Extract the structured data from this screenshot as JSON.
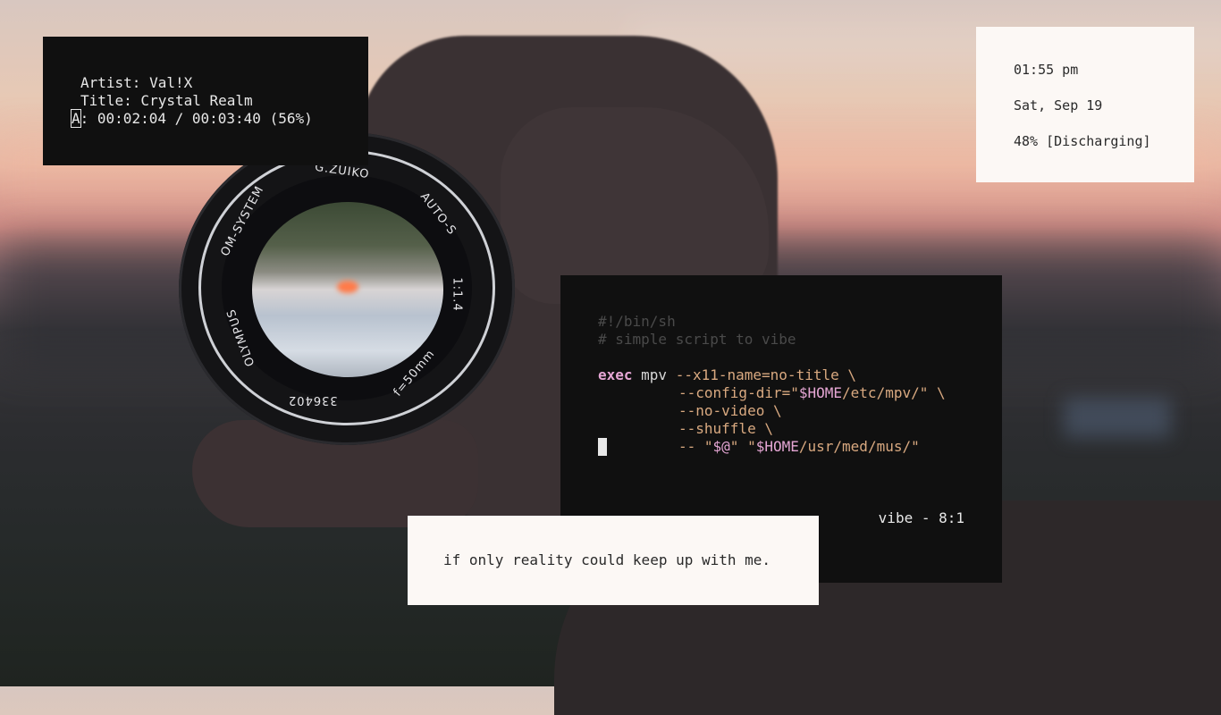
{
  "now_playing": {
    "artist": "Artist: Val!X",
    "title": "Title: Crystal Realm",
    "cursor_char": "A",
    "progress": ": 00:02:04 / 00:03:40 (56%)"
  },
  "status": {
    "time": "01:55 pm",
    "date": "Sat, Sep 19",
    "battery": "48% [Discharging]"
  },
  "lens_text": {
    "a": "G.ZUIKO",
    "b": "AUTO-S",
    "c": "OM-SYSTEM",
    "d": "OLYMPUS",
    "e": "1:1.4",
    "f": "f=50mm",
    "g": "336402"
  },
  "terminal": {
    "line1": "#!/bin/sh",
    "line2": "# simple script to vibe",
    "exec": "exec",
    "mpv": " mpv ",
    "opt1": "--x11-name=no-title \\",
    "opt2a": "--config-dir=\"",
    "home1": "$HOME",
    "opt2b": "/etc/mpv/\" \\",
    "opt3": "--no-video \\",
    "opt4": "--shuffle \\",
    "opt5a": "-- \"",
    "args": "$@",
    "opt5b": "\" \"",
    "home2": "$HOME",
    "opt5c": "/usr/med/mus/\"",
    "status": "vibe - 8:1"
  },
  "quote": {
    "text": "if only reality could keep up with me."
  },
  "colors": {
    "panel_dark": "#101010",
    "panel_light": "#fcf8f5",
    "keyword": "#e5a6d4",
    "flag": "#d9a980",
    "comment": "#4a4a4a"
  }
}
